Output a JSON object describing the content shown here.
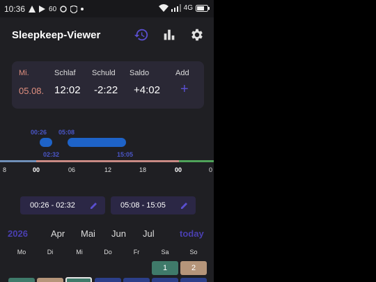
{
  "status_bar": {
    "time": "10:36",
    "battery_level_text": "60",
    "network_label": "4G"
  },
  "app": {
    "title": "Sleepkeep-Viewer",
    "accent_color": "#4a3fb0"
  },
  "summary": {
    "day": "Mi.",
    "date": "05.08.",
    "schlaf_label": "Schlaf",
    "schlaf_value": "12:02",
    "schuld_label": "Schuld",
    "schuld_value": "-2:22",
    "saldo_label": "Saldo",
    "saldo_value": "+4:02",
    "add_label": "Add",
    "add_symbol": "+"
  },
  "timeline": {
    "segments": [
      {
        "start": "00:26",
        "end": "02:32"
      },
      {
        "start": "05:08",
        "end": "15:05"
      }
    ],
    "ticks": [
      "8",
      "00",
      "06",
      "12",
      "18",
      "00",
      "0"
    ]
  },
  "chips": [
    {
      "label": "00:26 - 02:32"
    },
    {
      "label": "05:08 - 15:05"
    }
  ],
  "calendar": {
    "year": "2026",
    "months": [
      "Apr",
      "Mai",
      "Jun",
      "Jul"
    ],
    "today_label": "today",
    "weekdays": [
      "Mo",
      "Di",
      "Mi",
      "Do",
      "Fr",
      "Sa",
      "So"
    ],
    "first_row": [
      {
        "label": "1",
        "color": "#3f7a6a"
      },
      {
        "label": "2",
        "color": "#b5957a"
      }
    ]
  }
}
